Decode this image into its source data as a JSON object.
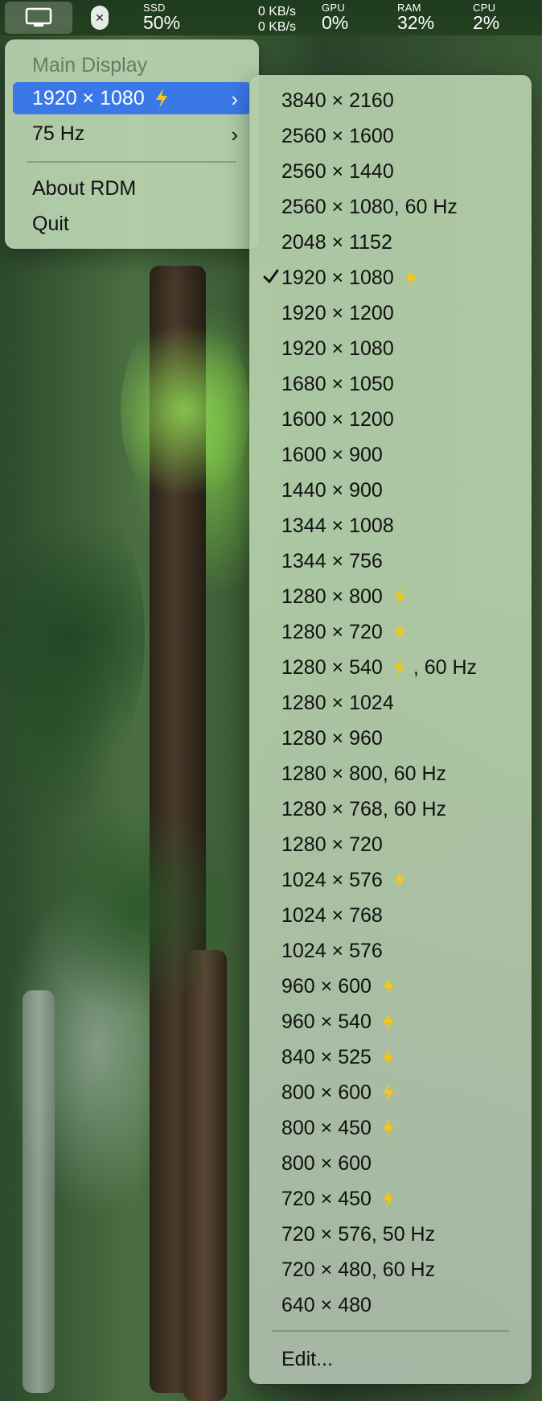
{
  "menubar": {
    "display_icon": "display-icon",
    "app_icon": "close-x-icon",
    "ssd": {
      "label": "SSD",
      "value": "50%"
    },
    "network": {
      "up": "0 KB/s",
      "down": "0 KB/s"
    },
    "gpu": {
      "label": "GPU",
      "value": "0%"
    },
    "ram": {
      "label": "RAM",
      "value": "32%"
    },
    "cpu": {
      "label": "CPU",
      "value": "2%"
    }
  },
  "main_menu": {
    "header": "Main Display",
    "resolution": "1920 × 1080",
    "refresh": "75 Hz",
    "about": "About RDM",
    "quit": "Quit"
  },
  "colors": {
    "selection": "#3b78e7",
    "bolt": "#f5c518"
  },
  "resolutions": [
    {
      "label": "3840 × 2160",
      "hidpi": false,
      "suffix": ""
    },
    {
      "label": "2560 × 1600",
      "hidpi": false,
      "suffix": ""
    },
    {
      "label": "2560 × 1440",
      "hidpi": false,
      "suffix": ""
    },
    {
      "label": "2560 × 1080, 60 Hz",
      "hidpi": false,
      "suffix": ""
    },
    {
      "label": "2048 × 1152",
      "hidpi": false,
      "suffix": ""
    },
    {
      "label": "1920 × 1080",
      "hidpi": true,
      "suffix": "",
      "checked": true
    },
    {
      "label": "1920 × 1200",
      "hidpi": false,
      "suffix": ""
    },
    {
      "label": "1920 × 1080",
      "hidpi": false,
      "suffix": ""
    },
    {
      "label": "1680 × 1050",
      "hidpi": false,
      "suffix": ""
    },
    {
      "label": "1600 × 1200",
      "hidpi": false,
      "suffix": ""
    },
    {
      "label": "1600 × 900",
      "hidpi": false,
      "suffix": ""
    },
    {
      "label": "1440 × 900",
      "hidpi": false,
      "suffix": ""
    },
    {
      "label": "1344 × 1008",
      "hidpi": false,
      "suffix": ""
    },
    {
      "label": "1344 × 756",
      "hidpi": false,
      "suffix": ""
    },
    {
      "label": "1280 × 800",
      "hidpi": true,
      "suffix": ""
    },
    {
      "label": "1280 × 720",
      "hidpi": true,
      "suffix": ""
    },
    {
      "label": "1280 × 540",
      "hidpi": true,
      "suffix": ", 60 Hz"
    },
    {
      "label": "1280 × 1024",
      "hidpi": false,
      "suffix": ""
    },
    {
      "label": "1280 × 960",
      "hidpi": false,
      "suffix": ""
    },
    {
      "label": "1280 × 800, 60 Hz",
      "hidpi": false,
      "suffix": ""
    },
    {
      "label": "1280 × 768, 60 Hz",
      "hidpi": false,
      "suffix": ""
    },
    {
      "label": "1280 × 720",
      "hidpi": false,
      "suffix": ""
    },
    {
      "label": "1024 × 576",
      "hidpi": true,
      "suffix": ""
    },
    {
      "label": "1024 × 768",
      "hidpi": false,
      "suffix": ""
    },
    {
      "label": "1024 × 576",
      "hidpi": false,
      "suffix": ""
    },
    {
      "label": "960 × 600",
      "hidpi": true,
      "suffix": ""
    },
    {
      "label": "960 × 540",
      "hidpi": true,
      "suffix": ""
    },
    {
      "label": "840 × 525",
      "hidpi": true,
      "suffix": ""
    },
    {
      "label": "800 × 600",
      "hidpi": true,
      "suffix": ""
    },
    {
      "label": "800 × 450",
      "hidpi": true,
      "suffix": ""
    },
    {
      "label": "800 × 600",
      "hidpi": false,
      "suffix": ""
    },
    {
      "label": "720 × 450",
      "hidpi": true,
      "suffix": ""
    },
    {
      "label": "720 × 576, 50 Hz",
      "hidpi": false,
      "suffix": ""
    },
    {
      "label": "720 × 480, 60 Hz",
      "hidpi": false,
      "suffix": ""
    },
    {
      "label": "640 × 480",
      "hidpi": false,
      "suffix": ""
    }
  ],
  "edit_label": "Edit..."
}
